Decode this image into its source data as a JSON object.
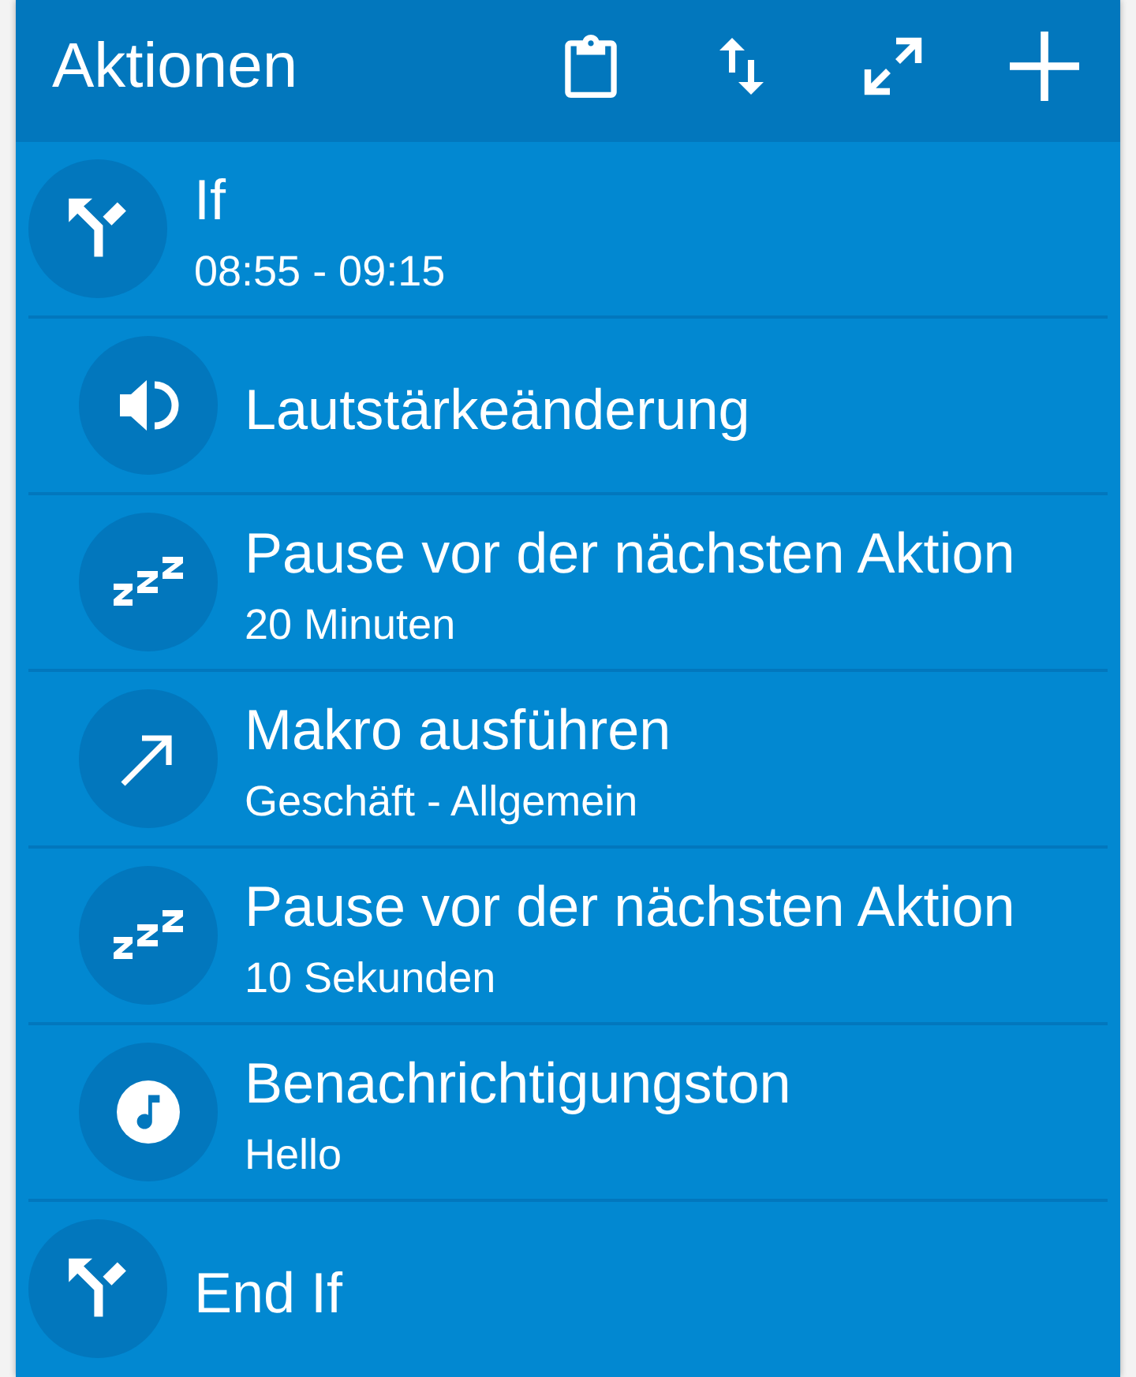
{
  "app_bar": {
    "title": "Aktionen"
  },
  "actions": [
    {
      "kind": "condition",
      "title": "If",
      "subtitle": "08:55 - 09:15",
      "children": [
        {
          "kind": "volume",
          "title": "Lautstärkeänderung"
        },
        {
          "kind": "wait",
          "title": "Pause vor der nächsten Aktion",
          "subtitle": "20 Minuten"
        },
        {
          "kind": "macro",
          "title": "Makro ausführen",
          "subtitle": "Geschäft - Allgemein"
        },
        {
          "kind": "wait",
          "title": "Pause vor der nächsten Aktion",
          "subtitle": "10 Sekunden"
        },
        {
          "kind": "sound",
          "title": "Benachrichtigungston",
          "subtitle": "Hello"
        }
      ]
    },
    {
      "kind": "condition",
      "title": "End If"
    }
  ]
}
